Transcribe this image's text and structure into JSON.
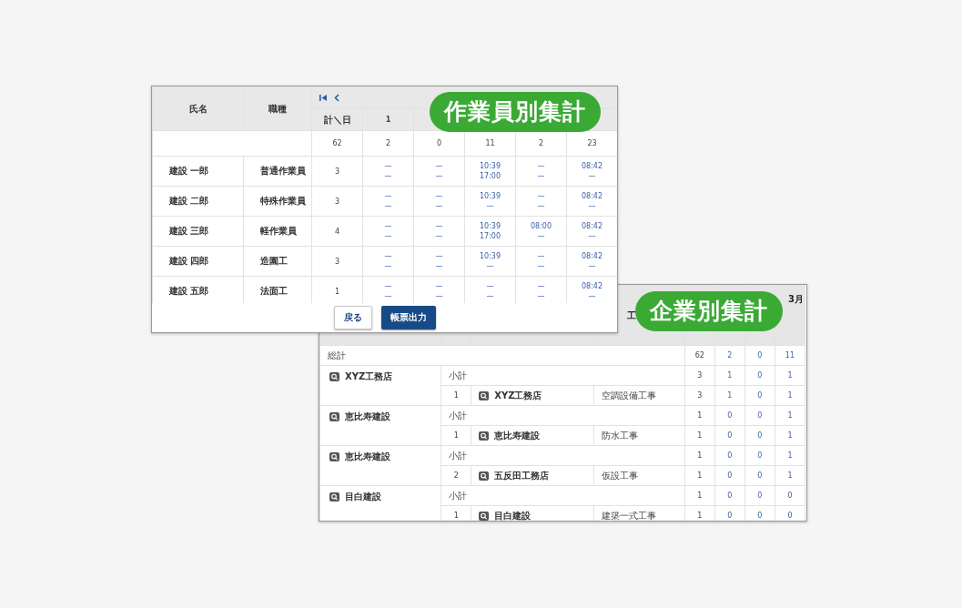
{
  "worker_report": {
    "badge": "作業員別集計",
    "header": {
      "name": "氏名",
      "job": "職種",
      "total": "計＼日",
      "days": [
        "1"
      ]
    },
    "totals": {
      "total": "62",
      "days": [
        "2",
        "0",
        "11",
        "2",
        "23"
      ]
    },
    "rows": [
      {
        "name": "建設 一郎",
        "job": "普通作業員",
        "total": "3",
        "days": [
          [
            "—",
            "—"
          ],
          [
            "—",
            "—"
          ],
          [
            "10:39",
            "17:00"
          ],
          [
            "—",
            "—"
          ],
          [
            "08:42",
            "—"
          ]
        ]
      },
      {
        "name": "建設 二郎",
        "job": "特殊作業員",
        "total": "3",
        "days": [
          [
            "—",
            "—"
          ],
          [
            "—",
            "—"
          ],
          [
            "10:39",
            "—"
          ],
          [
            "—",
            "—"
          ],
          [
            "08:42",
            "—"
          ]
        ]
      },
      {
        "name": "建設 三郎",
        "job": "軽作業員",
        "total": "4",
        "days": [
          [
            "—",
            "—"
          ],
          [
            "—",
            "—"
          ],
          [
            "10:39",
            "17:00"
          ],
          [
            "08:00",
            "—"
          ],
          [
            "08:42",
            "—"
          ]
        ]
      },
      {
        "name": "建設 四郎",
        "job": "造園工",
        "total": "3",
        "days": [
          [
            "—",
            "—"
          ],
          [
            "—",
            "—"
          ],
          [
            "10:39",
            "—"
          ],
          [
            "—",
            "—"
          ],
          [
            "08:42",
            "—"
          ]
        ]
      },
      {
        "name": "建設 五郎",
        "job": "法面工",
        "total": "1",
        "days": [
          [
            "—",
            "—"
          ],
          [
            "—",
            "—"
          ],
          [
            "—",
            "—"
          ],
          [
            "—",
            "—"
          ],
          [
            "08:42",
            "—"
          ]
        ]
      }
    ],
    "buttons": [
      {
        "label": "戻る",
        "kind": "back"
      },
      {
        "label": "帳票出力",
        "kind": "export"
      }
    ]
  },
  "company_report": {
    "badge": "企業別集計",
    "header": {
      "column_4": "工",
      "column_8": "3月"
    },
    "totals": {
      "label": "総計",
      "values": [
        "62",
        "2",
        "0",
        "11"
      ]
    },
    "groups": [
      {
        "company": "XYZ工務店",
        "subtotal_label": "小計",
        "subtotal": [
          "3",
          "1",
          "0",
          "1"
        ],
        "detail": {
          "no": "1",
          "name": "XYZ工務店",
          "trade": "空調設備工事",
          "values": [
            "3",
            "1",
            "0",
            "1"
          ]
        }
      },
      {
        "company": "恵比寿建設",
        "subtotal_label": "小計",
        "subtotal": [
          "1",
          "0",
          "0",
          "1"
        ],
        "detail": {
          "no": "1",
          "name": "恵比寿建設",
          "trade": "防水工事",
          "values": [
            "1",
            "0",
            "0",
            "1"
          ]
        }
      },
      {
        "company": "恵比寿建設",
        "subtotal_label": "小計",
        "subtotal": [
          "1",
          "0",
          "0",
          "1"
        ],
        "detail": {
          "no": "2",
          "name": "五反田工務店",
          "trade": "仮設工事",
          "values": [
            "1",
            "0",
            "0",
            "1"
          ]
        }
      },
      {
        "company": "目白建設",
        "subtotal_label": "小計",
        "subtotal": [
          "1",
          "0",
          "0",
          "0"
        ],
        "detail": {
          "no": "1",
          "name": "目白建設",
          "trade": "建築一式工事",
          "values": [
            "1",
            "0",
            "0",
            "0"
          ]
        }
      }
    ]
  }
}
